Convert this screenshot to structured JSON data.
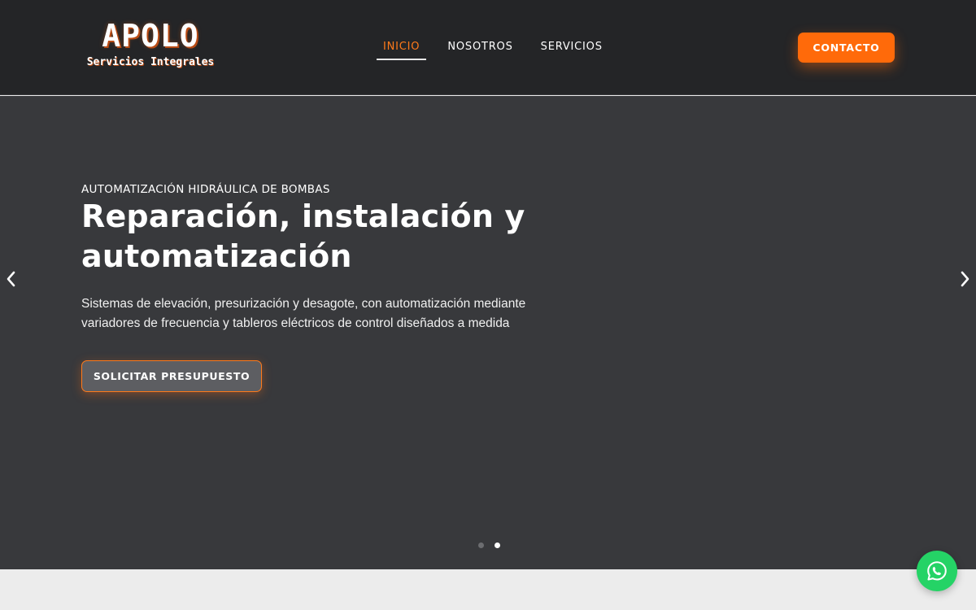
{
  "brand": {
    "name": "APOLO",
    "tagline": "Servicios Integrales"
  },
  "nav": {
    "items": [
      {
        "label": "INICIO",
        "active": true
      },
      {
        "label": "NOSOTROS",
        "active": false
      },
      {
        "label": "SERVICIOS",
        "active": false
      }
    ]
  },
  "header": {
    "cta_label": "CONTACTO"
  },
  "hero": {
    "eyebrow": "AUTOMATIZACIÓN HIDRÁULICA DE BOMBAS",
    "headline": "Reparación, instalación y automatización",
    "lead": "Sistemas de elevación, presurización y desagote, con automatización mediante variadores de frecuencia y tableros eléctricos de control diseñados a medida",
    "button_label": "SOLICITAR PRESUPUESTO",
    "slider": {
      "slide_count": 2,
      "active_slide": 2
    }
  },
  "icons": {
    "prev": "chevron-left-icon",
    "next": "chevron-right-icon",
    "whatsapp": "whatsapp-icon"
  },
  "colors": {
    "accent": "#ff6a0a",
    "header_bg": "#242527",
    "hero_bg": "#38393c",
    "whatsapp": "#25d366"
  }
}
